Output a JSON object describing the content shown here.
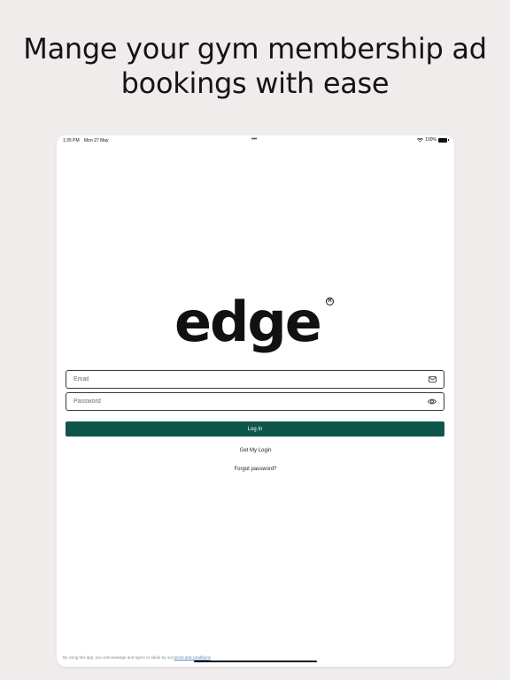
{
  "headline": {
    "line1": "Mange your gym membership ad",
    "line2": "bookings with ease"
  },
  "status_bar": {
    "time": "1:35 PM",
    "date": "Mon 27 May",
    "dots": "•••",
    "battery": "100%"
  },
  "logo": {
    "text": "edge",
    "mark": "R"
  },
  "form": {
    "email_placeholder": "Email",
    "email_icon": "envelope-icon",
    "password_placeholder": "Password",
    "password_icon": "eye-icon",
    "login_label": "Log In"
  },
  "links": {
    "get_login": "Get My Login",
    "forgot_password": "Forgot password?"
  },
  "footer": {
    "text": "By using this app, you acknowledge and agree to abide by our",
    "terms_link": "terms and conditions"
  },
  "colors": {
    "background": "#f0eceb",
    "primary": "#0e5649",
    "link": "#5a86b8"
  }
}
